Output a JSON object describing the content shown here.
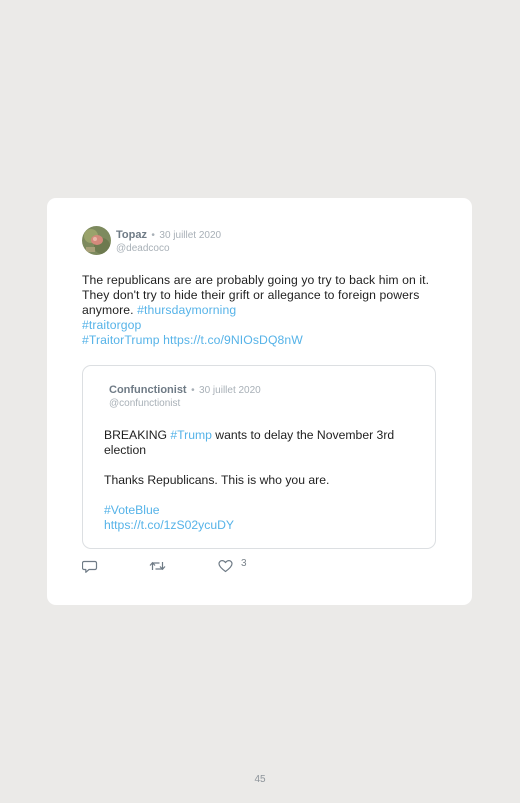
{
  "tweet": {
    "author": "Topaz",
    "separator": "•",
    "date": "30 juillet 2020",
    "handle": "@deadcoco",
    "text_main": "The republicans are are probably going yo try to back him on it. They don't try to hide their grift or allegance to foreign powers anymore. ",
    "hashtag1": "#thursdaymorning",
    "hashtag2": "#traitorgop",
    "hashtag3": "#TraitorTrump",
    "url": "https://t.co/9NIOsDQ8nW"
  },
  "quoted": {
    "author": "Confunctionist",
    "separator": "•",
    "date": "30 juillet 2020",
    "handle": "@confunctionist",
    "text_pre": "BREAKING ",
    "hashtag": "#Trump",
    "text_post": " wants to delay the November 3rd election",
    "line2": "Thanks Republicans. This is who you are.",
    "hashtag2": "#VoteBlue",
    "url": "https://t.co/1zS02ycuDY"
  },
  "actions": {
    "reply_icon": "reply-icon",
    "retweet_icon": "retweet-icon",
    "like_icon": "heart-icon",
    "like_count": "3"
  },
  "colors": {
    "link": "#56b3e8",
    "background": "#ebeae8",
    "card": "#ffffff"
  },
  "page": {
    "number": "45"
  }
}
